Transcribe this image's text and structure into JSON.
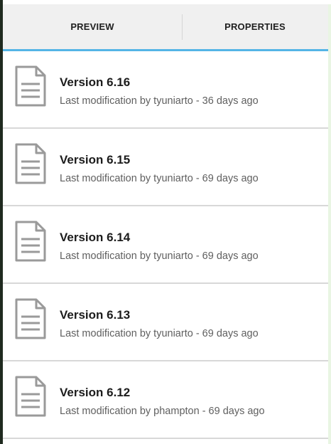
{
  "tabs": [
    {
      "label": "PREVIEW"
    },
    {
      "label": "PROPERTIES"
    }
  ],
  "versions": [
    {
      "icon": "document-icon",
      "title": "Version 6.16",
      "subtitle": "Last modification by tyuniarto - 36 days ago"
    },
    {
      "icon": "document-icon",
      "title": "Version 6.15",
      "subtitle": "Last modification by tyuniarto - 69 days ago"
    },
    {
      "icon": "document-icon",
      "title": "Version 6.14",
      "subtitle": "Last modification by tyuniarto - 69 days ago"
    },
    {
      "icon": "document-icon",
      "title": "Version 6.13",
      "subtitle": "Last modification by tyuniarto - 69 days ago"
    },
    {
      "icon": "document-icon",
      "title": "Version 6.12",
      "subtitle": "Last modification by phampton - 69 days ago"
    }
  ],
  "colors": {
    "tab_indicator": "#54b5e6",
    "frame_border": "#1f2a1f",
    "background": "#e9f5e3"
  }
}
